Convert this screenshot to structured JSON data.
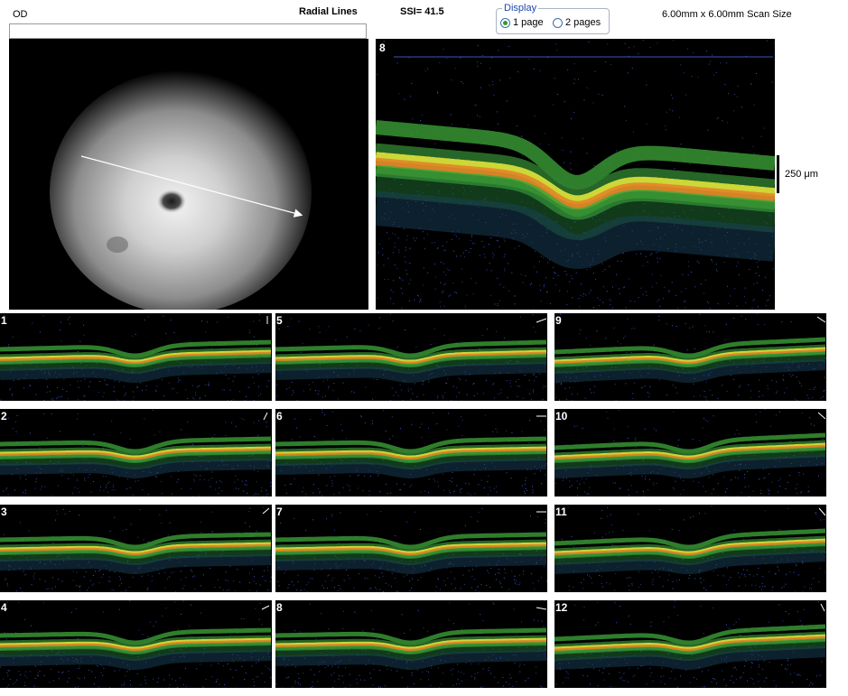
{
  "header": {
    "eye": "OD",
    "scan_type": "Radial Lines",
    "ssi": "SSI= 41.5",
    "scan_size": "6.00mm x 6.00mm Scan Size"
  },
  "display": {
    "legend": "Display",
    "options": [
      "1 page",
      "2 pages"
    ],
    "selected": "1 page"
  },
  "main_scan": {
    "label": "8",
    "scale": "250 μm"
  },
  "thumbnails": [
    "1",
    "2",
    "3",
    "4",
    "5",
    "6",
    "7",
    "8",
    "9",
    "10",
    "11",
    "12"
  ],
  "colors": {
    "retina_green": "#3fa83a",
    "retina_yellow": "#d8e33a",
    "rpe_orange": "#e08a28",
    "speckle_blue": "#3a55c0"
  }
}
